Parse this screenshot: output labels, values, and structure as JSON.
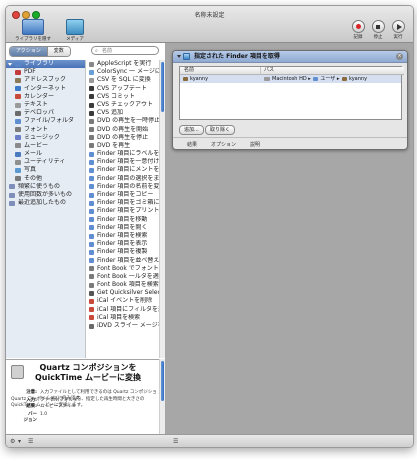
{
  "window": {
    "title": "名称未設定",
    "toolbar": {
      "library": "ライブラリを隠す",
      "media": "メディア",
      "record": "記録",
      "stop": "停止",
      "run": "実行"
    }
  },
  "sidebar": {
    "tabs": [
      "アクション",
      "変数"
    ],
    "search_placeholder": "名前",
    "categories": [
      {
        "label": "ライブラリ",
        "color": "#5a86c8",
        "top": true
      },
      {
        "label": "PDF",
        "color": "#c33c3c"
      },
      {
        "label": "アドレスブック",
        "color": "#8a7a5a"
      },
      {
        "label": "インターネット",
        "color": "#3b7bc9"
      },
      {
        "label": "カレンダー",
        "color": "#c84a3a"
      },
      {
        "label": "テキスト",
        "color": "#9a9a9a"
      },
      {
        "label": "デベロッパ",
        "color": "#6b6b6b"
      },
      {
        "label": "ファイル/フォルダ",
        "color": "#5f8fd0"
      },
      {
        "label": "フォント",
        "color": "#7b7b7b"
      },
      {
        "label": "ミュージック",
        "color": "#6a7fc8"
      },
      {
        "label": "ムービー",
        "color": "#8a8a8a"
      },
      {
        "label": "メール",
        "color": "#4a7bbf"
      },
      {
        "label": "ユーティリティ",
        "color": "#8f8f8f"
      },
      {
        "label": "写真",
        "color": "#5a9ad0"
      },
      {
        "label": "その他",
        "color": "#7a7a7a"
      },
      {
        "label": "頻繁に使うもの",
        "color": "#7d8fb8",
        "smart": true
      },
      {
        "label": "使用回数が多いもの",
        "color": "#7d8fb8",
        "smart": true
      },
      {
        "label": "最近追加したもの",
        "color": "#7d8fb8",
        "smart": true
      }
    ],
    "actions": [
      {
        "label": "AppleScript を実行",
        "color": "#888888"
      },
      {
        "label": "ColorSync 一 メージに適用",
        "color": "#6aa0d8"
      },
      {
        "label": "CSV を SQL に変換",
        "color": "#9a9a9a"
      },
      {
        "label": "CVS アップデート",
        "color": "#3a3a3a"
      },
      {
        "label": "CVS コミット",
        "color": "#3a3a3a"
      },
      {
        "label": "CVS チェックアウト",
        "color": "#3a3a3a"
      },
      {
        "label": "CVS 追加",
        "color": "#3a3a3a"
      },
      {
        "label": "DVD の再生を一時停止",
        "color": "#7a7a7a"
      },
      {
        "label": "DVD の再生を開始",
        "color": "#7a7a7a"
      },
      {
        "label": "DVD の再生を停止",
        "color": "#7a7a7a"
      },
      {
        "label": "DVD を再生",
        "color": "#7a7a7a"
      },
      {
        "label": "Finder 項目にラベルを適用",
        "color": "#5f8fd0"
      },
      {
        "label": "Finder 項目を一意付けする",
        "color": "#5f8fd0"
      },
      {
        "label": "Finder 項目にメントを設定",
        "color": "#5f8fd0"
      },
      {
        "label": "Finder 項目の選択をまとめる",
        "color": "#5f8fd0"
      },
      {
        "label": "Finder 項目の名前を変更",
        "color": "#5f8fd0"
      },
      {
        "label": "Finder 項目をコピー",
        "color": "#5f8fd0"
      },
      {
        "label": "Finder 項目をゴミ箱に入れる",
        "color": "#5f8fd0"
      },
      {
        "label": "Finder 項目をプリント",
        "color": "#5f8fd0"
      },
      {
        "label": "Finder 項目を移動",
        "color": "#5f8fd0"
      },
      {
        "label": "Finder 項目を開く",
        "color": "#5f8fd0"
      },
      {
        "label": "Finder 項目を検索",
        "color": "#5f8fd0"
      },
      {
        "label": "Finder 項目を表示",
        "color": "#5f8fd0"
      },
      {
        "label": "Finder 項目を複製",
        "color": "#5f8fd0"
      },
      {
        "label": "Finder 項目を並べ替える",
        "color": "#5f8fd0"
      },
      {
        "label": "Font Book でフォントを選択",
        "color": "#7b7b7b"
      },
      {
        "label": "Font Book 一ルタを適用",
        "color": "#7b7b7b"
      },
      {
        "label": "Font Book 項目を検索",
        "color": "#7b7b7b"
      },
      {
        "label": "Get Quicksilver Selection",
        "color": "#555555"
      },
      {
        "label": "iCal イベントを削除",
        "color": "#c84a3a"
      },
      {
        "label": "iCal 項目にフィルタを適用",
        "color": "#c84a3a"
      },
      {
        "label": "iCal 項目を検索",
        "color": "#c84a3a"
      },
      {
        "label": "iDVD スライ一 メージを取得",
        "color": "#6a6a6a"
      }
    ]
  },
  "description": {
    "title": "Quartz コンポジションを QuickTime ムービーに変換",
    "body": "Quartz コンポジションファイルを、指定した再生時間と大きさの QuickTime ムービーに変換します。",
    "note_label": "注意:",
    "note": "入力ファイルとして利用できるのは Quartz コンポジション（.qtz）のみです。",
    "input_label": "入力:",
    "input": "ファイル/フォルダ",
    "result_label": "結果:",
    "result": "ムービーファイル",
    "version_label": "バー",
    "version": "1.0",
    "john_label": "ジョン"
  },
  "workflow": {
    "action_title": "指定された Finder 項目を取得",
    "columns": {
      "name": "名前",
      "path": "パス"
    },
    "rows": [
      {
        "name": "kyanny",
        "path": "Macintosh HD ▸ ユーザ ▸ kyanny"
      }
    ],
    "path_parts": [
      "Macintosh HD",
      "ユーザ",
      "kyanny"
    ],
    "add_button": "追加...",
    "remove_button": "取り除く",
    "tabs": [
      "結果",
      "オプション",
      "説明"
    ]
  },
  "bottombar": {
    "gear": "⚙",
    "menu": "▾",
    "list": "☰",
    "list2": "☰"
  }
}
